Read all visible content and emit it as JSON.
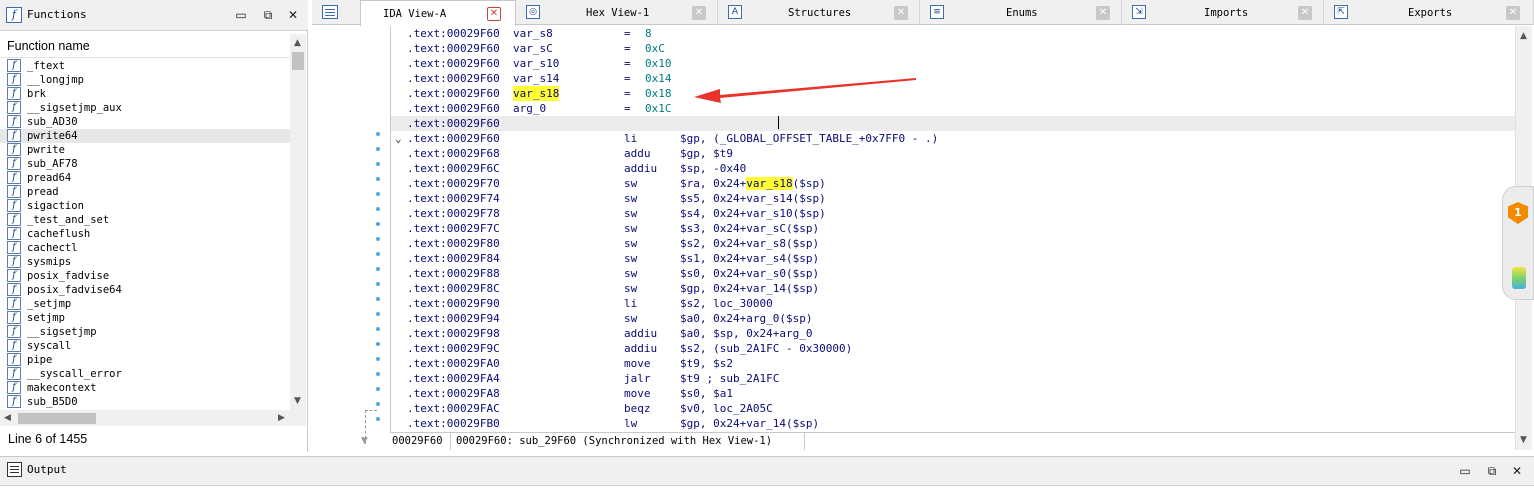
{
  "functions_panel": {
    "title": "Functions",
    "column_header": "Function name",
    "icon": "function-icon",
    "items": [
      "_ftext",
      "__longjmp",
      "brk",
      "__sigsetjmp_aux",
      "sub_AD30",
      "pwrite64",
      "pwrite",
      "sub_AF78",
      "pread64",
      "pread",
      "sigaction",
      "_test_and_set",
      "cacheflush",
      "cachectl",
      "sysmips",
      "posix_fadvise",
      "posix_fadvise64",
      "_setjmp",
      "setjmp",
      "__sigsetjmp",
      "syscall",
      "pipe",
      "__syscall_error",
      "makecontext",
      "sub_B5D0"
    ],
    "selected_index": 5,
    "status": "Line 6 of 1455",
    "window_buttons": {
      "minimize": "▭",
      "restore": "⧉",
      "close": "✕"
    }
  },
  "tabs": [
    {
      "label": "IDA View-A",
      "icon": "ida-view-icon",
      "active": true
    },
    {
      "label": "Hex View-1",
      "icon": "hex-view-icon",
      "active": false
    },
    {
      "label": "Structures",
      "icon": "structures-icon",
      "active": false
    },
    {
      "label": "Enums",
      "icon": "enums-icon",
      "active": false
    },
    {
      "label": "Imports",
      "icon": "imports-icon",
      "active": false
    },
    {
      "label": "Exports",
      "icon": "exports-icon",
      "active": false
    }
  ],
  "disasm": {
    "vars": [
      {
        "addr": ".text:00029F60",
        "name": "var_s8",
        "val": "8"
      },
      {
        "addr": ".text:00029F60",
        "name": "var_sC",
        "val": "0xC"
      },
      {
        "addr": ".text:00029F60",
        "name": "var_s10",
        "val": "0x10"
      },
      {
        "addr": ".text:00029F60",
        "name": "var_s14",
        "val": "0x14"
      },
      {
        "addr": ".text:00029F60",
        "name": "var_s18",
        "val": "0x18",
        "highlight": true
      },
      {
        "addr": ".text:00029F60",
        "name": "arg_0",
        "val": "0x1C"
      }
    ],
    "current_line": ".text:00029F60",
    "instructions": [
      {
        "addr": ".text:00029F60",
        "mn": "li",
        "ops": "$gp, (_GLOBAL_OFFSET_TABLE_+0x7FF0 - .)"
      },
      {
        "addr": ".text:00029F68",
        "mn": "addu",
        "ops": "$gp, $t9"
      },
      {
        "addr": ".text:00029F6C",
        "mn": "addiu",
        "ops": "$sp, -0x40"
      },
      {
        "addr": ".text:00029F70",
        "mn": "sw",
        "ops_pre": "$ra, 0x24+",
        "ops_hl": "var_s18",
        "ops_post": "($sp)"
      },
      {
        "addr": ".text:00029F74",
        "mn": "sw",
        "ops": "$s5, 0x24+var_s14($sp)"
      },
      {
        "addr": ".text:00029F78",
        "mn": "sw",
        "ops": "$s4, 0x24+var_s10($sp)"
      },
      {
        "addr": ".text:00029F7C",
        "mn": "sw",
        "ops": "$s3, 0x24+var_sC($sp)"
      },
      {
        "addr": ".text:00029F80",
        "mn": "sw",
        "ops": "$s2, 0x24+var_s8($sp)"
      },
      {
        "addr": ".text:00029F84",
        "mn": "sw",
        "ops": "$s1, 0x24+var_s4($sp)"
      },
      {
        "addr": ".text:00029F88",
        "mn": "sw",
        "ops": "$s0, 0x24+var_s0($sp)"
      },
      {
        "addr": ".text:00029F8C",
        "mn": "sw",
        "ops": "$gp, 0x24+var_14($sp)"
      },
      {
        "addr": ".text:00029F90",
        "mn": "li",
        "ops": "$s2, loc_30000"
      },
      {
        "addr": ".text:00029F94",
        "mn": "sw",
        "ops": "$a0, 0x24+arg_0($sp)"
      },
      {
        "addr": ".text:00029F98",
        "mn": "addiu",
        "ops": "$a0, $sp, 0x24+arg_0"
      },
      {
        "addr": ".text:00029F9C",
        "mn": "addiu",
        "ops": "$s2, (sub_2A1FC - 0x30000)"
      },
      {
        "addr": ".text:00029FA0",
        "mn": "move",
        "ops": "$t9, $s2"
      },
      {
        "addr": ".text:00029FA4",
        "mn": "jalr",
        "ops": "$t9 ; sub_2A1FC"
      },
      {
        "addr": ".text:00029FA8",
        "mn": "move",
        "ops": "$s0, $a1"
      },
      {
        "addr": ".text:00029FAC",
        "mn": "beqz",
        "ops": "$v0, loc_2A05C"
      },
      {
        "addr": ".text:00029FB0",
        "mn": "lw",
        "ops": "$gp, 0x24+var_14($sp)"
      }
    ],
    "status_left": "00029F60",
    "status_right": "00029F60: sub_29F60 (Synchronized with Hex View-1)"
  },
  "float_widget": {
    "badge": "1"
  },
  "output_panel": {
    "title": "Output",
    "icon": "output-icon"
  },
  "colors": {
    "highlight": "#ffff33",
    "arrow": "#e8322a",
    "text": "#0a0a78",
    "number": "#007a7a"
  }
}
